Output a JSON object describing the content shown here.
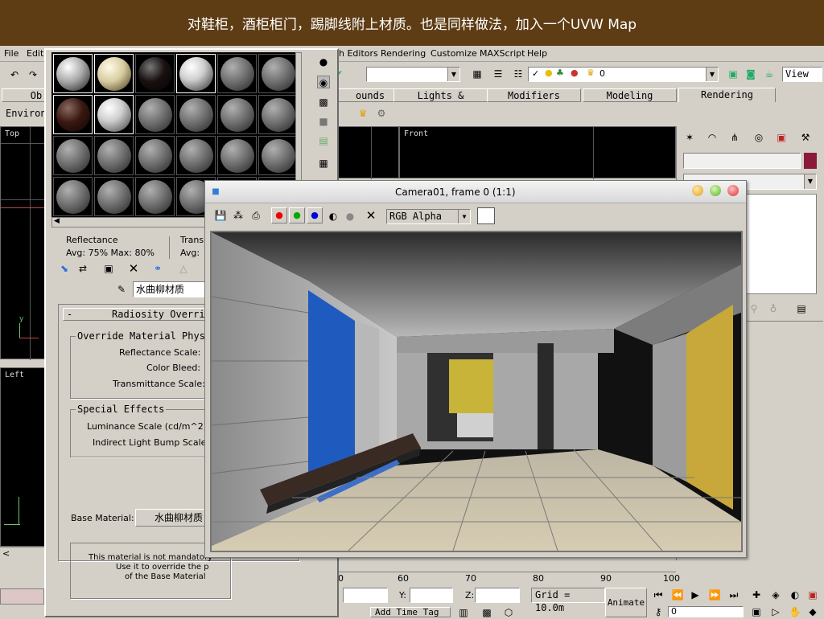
{
  "banner": {
    "caption": "对鞋柜，酒柜柜门，踢脚线附上材质。也是同样做法，加入一个UVW Map"
  },
  "menu": {
    "file": "File",
    "edit": "Edit",
    "graph_editors": "h Editors",
    "rendering": "Rendering",
    "customize": "Customize",
    "maxscript": "MAXScript",
    "help": "Help"
  },
  "toolbar": {
    "selection_count": "0",
    "view_dropdown": "View"
  },
  "tabs": {
    "objects": "Ob",
    "lights_cameras": "Lights & Cameras",
    "bounds": "ounds",
    "modifiers": "Modifiers",
    "modeling": "Modeling",
    "rendering": "Rendering"
  },
  "panel": {
    "environ_label": "Environ"
  },
  "viewports": {
    "top": "Top",
    "front": "Front",
    "left": "Left"
  },
  "material_editor": {
    "reflectance_label": "Reflectance",
    "reflectance_value": "Avg:  75% Max:  80%",
    "transmittance_label": "Transm",
    "transmittance_value": "Avg:",
    "material_name": "水曲柳材质",
    "rollout_title": "Radiosity Overri",
    "group_override": "Override Material Phys:",
    "reflectance_scale": "Reflectance Scale:",
    "color_bleed": "Color Bleed:",
    "transmittance_scale": "Transmittance Scale:",
    "group_special": "Special Effects",
    "luminance_scale": "Luminance Scale (cd/m^2):",
    "indirect_bump": "Indirect Light Bump Scale:",
    "base_material_label": "Base Material:",
    "base_material_value": "水曲柳材质",
    "note_line1": "This material is not mandatory",
    "note_line2": "Use it to override the p",
    "note_line3": "of the Base Material",
    "rollout_minus": "-"
  },
  "render_window": {
    "title": "Camera01, frame 0 (1:1)",
    "channel": "RGB Alpha"
  },
  "timeline": {
    "ticks": [
      "60",
      "70",
      "80",
      "90",
      "100"
    ],
    "zero_tick": "0"
  },
  "status": {
    "x_label": "",
    "y_label": "Y:",
    "z_label": "Z:",
    "grid": "Grid = 10.0m",
    "animate": "Animate",
    "add_time_tag": "Add Time Tag",
    "frame_value": "0"
  },
  "colors": {
    "banner": "#5e3c14",
    "accent": "#8b1a3a",
    "ui": "#d4d0c8"
  }
}
